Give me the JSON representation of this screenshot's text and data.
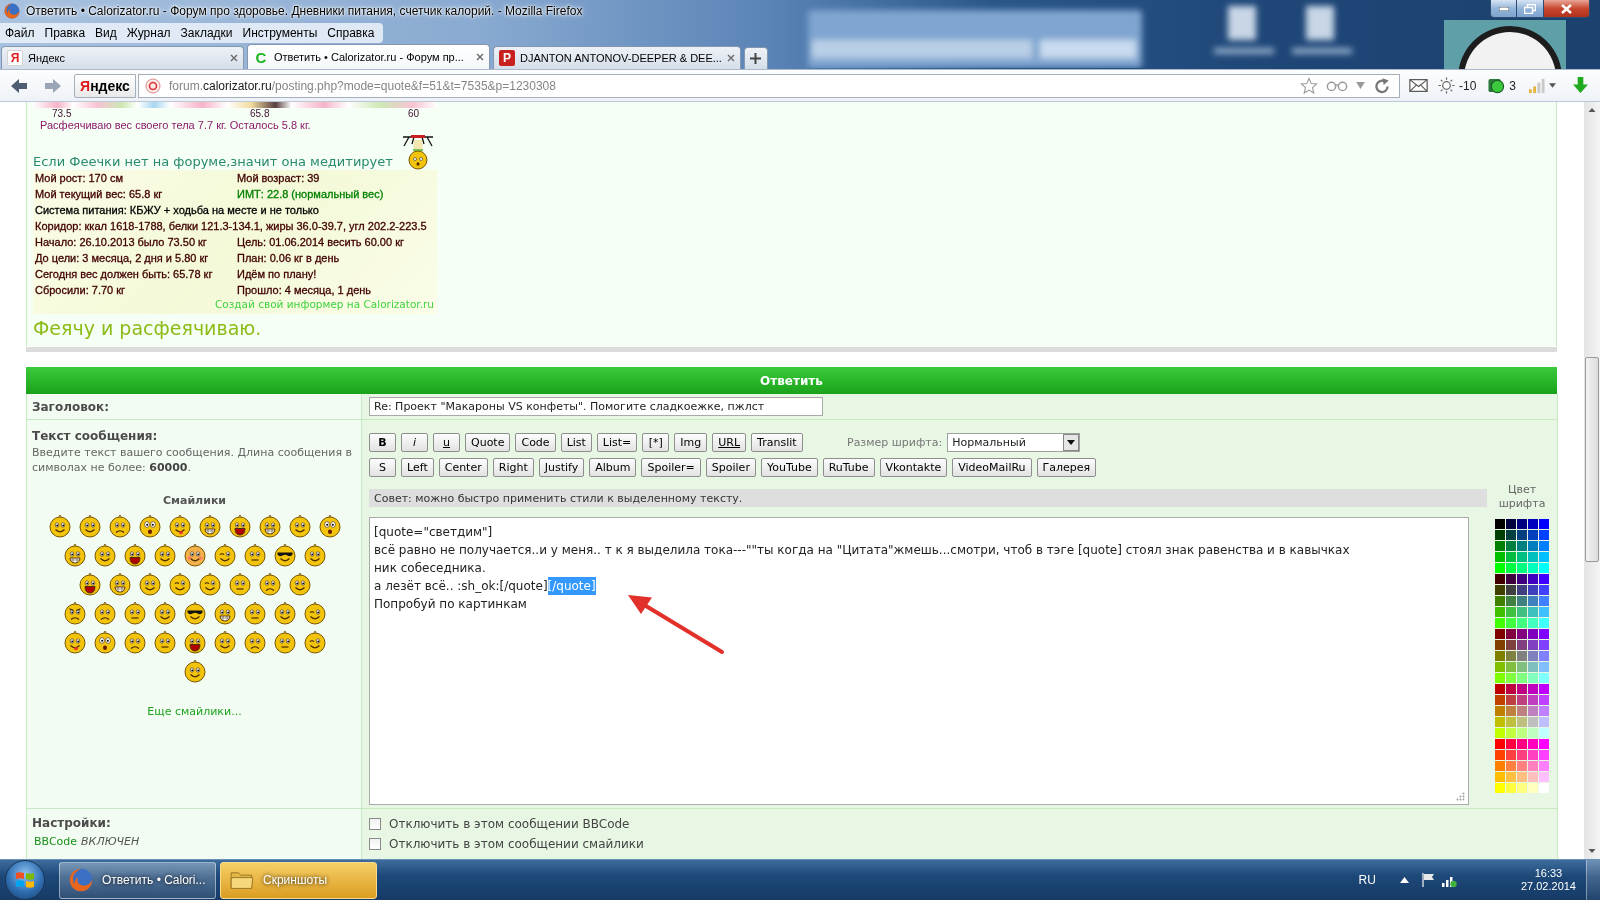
{
  "window": {
    "title": "Ответить • Calorizator.ru - Форум про здоровье. Дневники питания, счетчик калорий. - Mozilla Firefox"
  },
  "menu": [
    "Файл",
    "Правка",
    "Вид",
    "Журнал",
    "Закладки",
    "Инструменты",
    "Справка"
  ],
  "tabs": [
    {
      "favicon": "Я",
      "label": "Яндекс",
      "kind": "yandex",
      "selected": false
    },
    {
      "favicon": "C",
      "label": "Ответить • Calorizator.ru - Форум пр...",
      "kind": "forum",
      "selected": true
    },
    {
      "favicon": "P",
      "label": "DJANTON ANTONOV-DEEPER & DEE...",
      "kind": "media",
      "selected": false
    }
  ],
  "navigation": {
    "home_button": "Яндекс",
    "url": "forum.**calorizator.ru**/posting.php?mode=quote&f=51&t=7535&p=1230308",
    "weather": "-10",
    "badge_count": "3"
  },
  "ticker": {
    "labels": [
      "73.5",
      "65.8",
      "60"
    ],
    "caption": "Расфеячиваю вес своего тела 7.7 кг. Осталось 5.8 кг."
  },
  "informer": {
    "heading": "Если Феечки нет на форуме,значит она медитирует",
    "rows": [
      {
        "cells": [
          {
            "text": "Мой рост: 170 см",
            "color": "#400000"
          },
          {
            "text": "Мой возраст: 39",
            "color": "#400000"
          }
        ]
      },
      {
        "cells": [
          {
            "text": "Мой текущий вес: 65.8 кг",
            "color": "#400000"
          },
          {
            "text": "ИМТ: 22.8 (нормальный вес)",
            "color": "#008000"
          }
        ]
      },
      {
        "cells": [
          {
            "text": "Система питания: КБЖУ + ходьба на месте и не только",
            "color": "#000000"
          }
        ]
      },
      {
        "cells": [
          {
            "text": "Коридор: ккал 1618-1788, белки 121.3-134.1, жиры 36.0-39.7, угл 202.2-223.5",
            "color": "#400000"
          }
        ]
      },
      {
        "cells": [
          {
            "text": "Начало: 26.10.2013 было 73.50 кг",
            "color": "#400000"
          },
          {
            "text": "Цель: 01.06.2014 весить 60.00 кг",
            "color": "#400000"
          }
        ]
      },
      {
        "cells": [
          {
            "text": "До цели: 3 месяца, 2 дня и 5.80 кг",
            "color": "#400000"
          },
          {
            "text": "План: 0.06 кг в день",
            "color": "#400000"
          }
        ]
      },
      {
        "cells": [
          {
            "text": "Сегодня вес должен быть: 65.78 кг",
            "color": "#400000"
          },
          {
            "text": "Идём по плану!",
            "color": "#400000"
          }
        ]
      },
      {
        "cells": [
          {
            "text": "Сбросили: 7.70 кг",
            "color": "#400000"
          },
          {
            "text": "Прошло: 4 месяца, 1 день",
            "color": "#400000"
          }
        ]
      }
    ],
    "link": "Создай свой информер на Calorizator.ru"
  },
  "signature": "Феячу и расфеячиваю.",
  "reply_form": {
    "header": "Ответить",
    "subject": {
      "label": "Заголовок:",
      "value": "Re: Проект \"Макароны VS конфеты\". Помогите сладкоежке, пжлст"
    },
    "message": {
      "label": "Текст сообщения:",
      "hint": "Введите текст вашего сообщения. Длина сообщения в символах не более: **60000**.",
      "smileys_title": "Смайлики",
      "smiley_rows": [
        [
          {
            "kind": "smile"
          },
          {
            "kind": "smile"
          },
          {
            "kind": "sad"
          },
          {
            "kind": "shocked"
          },
          {
            "kind": "tongue"
          },
          {
            "kind": "grin"
          },
          {
            "kind": "laugh"
          },
          {
            "kind": "grin"
          },
          {
            "kind": "smile"
          },
          {
            "kind": "shocked"
          }
        ],
        [
          {
            "kind": "grin"
          },
          {
            "kind": "smile"
          },
          {
            "kind": "laugh"
          },
          {
            "kind": "smile"
          },
          {
            "kind": "blush"
          },
          {
            "kind": "wink"
          },
          {
            "kind": "neutral"
          },
          {
            "kind": "cool"
          },
          {
            "kind": "smile"
          }
        ],
        [
          {
            "kind": "laugh"
          },
          {
            "kind": "grin"
          },
          {
            "kind": "smile"
          },
          {
            "kind": "wink"
          },
          {
            "kind": "wink"
          },
          {
            "kind": "neutral"
          },
          {
            "kind": "sad"
          },
          {
            "kind": "smile"
          }
        ],
        [
          {
            "kind": "angry"
          },
          {
            "kind": "sad"
          },
          {
            "kind": "neutral"
          },
          {
            "kind": "smile"
          },
          {
            "kind": "cool"
          },
          {
            "kind": "grin"
          },
          {
            "kind": "neutral"
          },
          {
            "kind": "smile"
          },
          {
            "kind": "wink"
          }
        ],
        [
          {
            "kind": "tongue"
          },
          {
            "kind": "shocked"
          },
          {
            "kind": "sad"
          },
          {
            "kind": "neutral"
          },
          {
            "kind": "laugh"
          },
          {
            "kind": "smile"
          },
          {
            "kind": "sad"
          },
          {
            "kind": "neutral"
          },
          {
            "kind": "wink"
          }
        ],
        [
          {
            "kind": "smile"
          }
        ]
      ],
      "more_smileys": "Еще смайлики...",
      "toolbar_rows": [
        [
          {
            "label": "B",
            "kind": "bold"
          },
          {
            "label": "i",
            "kind": "italic"
          },
          {
            "label": "u",
            "kind": "underline"
          },
          {
            "label": "Quote",
            "kind": "plain"
          },
          {
            "label": "Code",
            "kind": "plain"
          },
          {
            "label": "List",
            "kind": "plain"
          },
          {
            "label": "List=",
            "kind": "plain"
          },
          {
            "label": "[*]",
            "kind": "plain"
          },
          {
            "label": "Img",
            "kind": "plain"
          },
          {
            "label": "URL",
            "kind": "underline"
          },
          {
            "label": "Translit",
            "kind": "plain"
          }
        ],
        [
          {
            "label": "S",
            "kind": "plain"
          },
          {
            "label": "Left",
            "kind": "plain"
          },
          {
            "label": "Center",
            "kind": "plain"
          },
          {
            "label": "Right",
            "kind": "plain"
          },
          {
            "label": "Justify",
            "kind": "plain"
          },
          {
            "label": "Album",
            "kind": "plain"
          },
          {
            "label": "Spoiler=",
            "kind": "plain"
          },
          {
            "label": "Spoiler",
            "kind": "plain"
          },
          {
            "label": "YouTube",
            "kind": "plain"
          },
          {
            "label": "RuTube",
            "kind": "plain"
          },
          {
            "label": "Vkontakte",
            "kind": "plain"
          },
          {
            "label": "VideoMailRu",
            "kind": "plain"
          },
          {
            "label": "Галерея",
            "kind": "plain"
          }
        ]
      ],
      "font_size": {
        "label": "Размер шрифта:",
        "value": "Нормальный"
      },
      "tip": "Совет: можно быстро применить стили к выделенному тексту.",
      "color_label": "Цвет шрифта",
      "palette": [
        {
          "color": "#000000"
        },
        {
          "color": "#000040"
        },
        {
          "color": "#000080"
        },
        {
          "color": "#0000bf"
        },
        {
          "color": "#0000ff"
        },
        {
          "color": "#004000"
        },
        {
          "color": "#004040"
        },
        {
          "color": "#004080"
        },
        {
          "color": "#0040bf"
        },
        {
          "color": "#0040ff"
        },
        {
          "color": "#008000"
        },
        {
          "color": "#008040"
        },
        {
          "color": "#008080"
        },
        {
          "color": "#0080bf"
        },
        {
          "color": "#0080ff"
        },
        {
          "color": "#00bf00"
        },
        {
          "color": "#00bf40"
        },
        {
          "color": "#00bf80"
        },
        {
          "color": "#00bfbf"
        },
        {
          "color": "#00bfff"
        },
        {
          "color": "#00ff00"
        },
        {
          "color": "#00ff40"
        },
        {
          "color": "#00ff80"
        },
        {
          "color": "#00ffbf"
        },
        {
          "color": "#00ffff"
        },
        {
          "color": "#400000"
        },
        {
          "color": "#400040"
        },
        {
          "color": "#400080"
        },
        {
          "color": "#4000bf"
        },
        {
          "color": "#4000ff"
        },
        {
          "color": "#404000"
        },
        {
          "color": "#404040"
        },
        {
          "color": "#404080"
        },
        {
          "color": "#4040bf"
        },
        {
          "color": "#4040ff"
        },
        {
          "color": "#408000"
        },
        {
          "color": "#408040"
        },
        {
          "color": "#408080"
        },
        {
          "color": "#4080bf"
        },
        {
          "color": "#4080ff"
        },
        {
          "color": "#40bf00"
        },
        {
          "color": "#40bf40"
        },
        {
          "color": "#40bf80"
        },
        {
          "color": "#40bfbf"
        },
        {
          "color": "#40bfff"
        },
        {
          "color": "#40ff00"
        },
        {
          "color": "#40ff40"
        },
        {
          "color": "#40ff80"
        },
        {
          "color": "#40ffbf"
        },
        {
          "color": "#40ffff"
        },
        {
          "color": "#800000"
        },
        {
          "color": "#800040"
        },
        {
          "color": "#800080"
        },
        {
          "color": "#8000bf"
        },
        {
          "color": "#8000ff"
        },
        {
          "color": "#804000"
        },
        {
          "color": "#804040"
        },
        {
          "color": "#804080"
        },
        {
          "color": "#8040bf"
        },
        {
          "color": "#8040ff"
        },
        {
          "color": "#808000"
        },
        {
          "color": "#808040"
        },
        {
          "color": "#808080"
        },
        {
          "color": "#8080bf"
        },
        {
          "color": "#8080ff"
        },
        {
          "color": "#80bf00"
        },
        {
          "color": "#80bf40"
        },
        {
          "color": "#80bf80"
        },
        {
          "color": "#80bfbf"
        },
        {
          "color": "#80bfff"
        },
        {
          "color": "#80ff00"
        },
        {
          "color": "#80ff40"
        },
        {
          "color": "#80ff80"
        },
        {
          "color": "#80ffbf"
        },
        {
          "color": "#80ffff"
        },
        {
          "color": "#bf0000"
        },
        {
          "color": "#bf0040"
        },
        {
          "color": "#bf0080"
        },
        {
          "color": "#bf00bf"
        },
        {
          "color": "#bf00ff"
        },
        {
          "color": "#bf4000"
        },
        {
          "color": "#bf4040"
        },
        {
          "color": "#bf4080"
        },
        {
          "color": "#bf40bf"
        },
        {
          "color": "#bf40ff"
        },
        {
          "color": "#bf8000"
        },
        {
          "color": "#bf8040"
        },
        {
          "color": "#bf8080"
        },
        {
          "color": "#bf80bf"
        },
        {
          "color": "#bf80ff"
        },
        {
          "color": "#bfbf00"
        },
        {
          "color": "#bfbf40"
        },
        {
          "color": "#bfbf80"
        },
        {
          "color": "#bfbfbf"
        },
        {
          "color": "#bfbfff"
        },
        {
          "color": "#bfff00"
        },
        {
          "color": "#bfff40"
        },
        {
          "color": "#bfff80"
        },
        {
          "color": "#bfffbf"
        },
        {
          "color": "#bfffff"
        },
        {
          "color": "#ff0000"
        },
        {
          "color": "#ff0040"
        },
        {
          "color": "#ff0080"
        },
        {
          "color": "#ff00bf"
        },
        {
          "color": "#ff00ff"
        },
        {
          "color": "#ff4000"
        },
        {
          "color": "#ff4040"
        },
        {
          "color": "#ff4080"
        },
        {
          "color": "#ff40bf"
        },
        {
          "color": "#ff40ff"
        },
        {
          "color": "#ff8000"
        },
        {
          "color": "#ff8040"
        },
        {
          "color": "#ff8080"
        },
        {
          "color": "#ff80bf"
        },
        {
          "color": "#ff80ff"
        },
        {
          "color": "#ffbf00"
        },
        {
          "color": "#ffbf40"
        },
        {
          "color": "#ffbf80"
        },
        {
          "color": "#ffbfbf"
        },
        {
          "color": "#ffbfff"
        },
        {
          "color": "#ffff00"
        },
        {
          "color": "#ffff40"
        },
        {
          "color": "#ffff80"
        },
        {
          "color": "#ffffbf"
        },
        {
          "color": "#ffffff"
        }
      ],
      "lines": [
        {
          "segments": [
            {
              "text": "[quote=\"светдим\"]",
              "selected": false
            }
          ]
        },
        {
          "segments": [
            {
              "text": "всё равно не получается..и у меня.. т к я выделила тока---\"\"ты когда на \"Цитата\"жмешь...смотри, чтоб в тэге [quote] стоял знак равенства и в кавычках",
              "selected": false
            }
          ]
        },
        {
          "segments": [
            {
              "text": "ник собеседника.",
              "selected": false
            }
          ]
        },
        {
          "segments": [
            {
              "text": "а лезёт всё.. :sh_ok:[/quote]",
              "selected": false
            },
            {
              "text": "[/quote]",
              "selected": true
            }
          ]
        },
        {
          "segments": [
            {
              "text": "Попробуй по картинкам",
              "selected": false
            }
          ]
        }
      ]
    },
    "settings": {
      "label": "Настройки:",
      "bbcode_link": "BBCode",
      "bbcode_status": "ВКЛЮЧЕН",
      "options": [
        {
          "label": "Отключить в этом сообщении BBCode",
          "checked": false
        },
        {
          "label": "Отключить в этом сообщении смайлики",
          "checked": false
        }
      ]
    }
  },
  "taskbar": {
    "items": [
      {
        "label": "Ответить • Calori...",
        "kind": "firefox",
        "highlighted": false
      },
      {
        "label": "Скриншоты",
        "kind": "folder",
        "highlighted": true
      }
    ],
    "language": "RU",
    "time": "16:33",
    "date": "27.02.2014"
  }
}
